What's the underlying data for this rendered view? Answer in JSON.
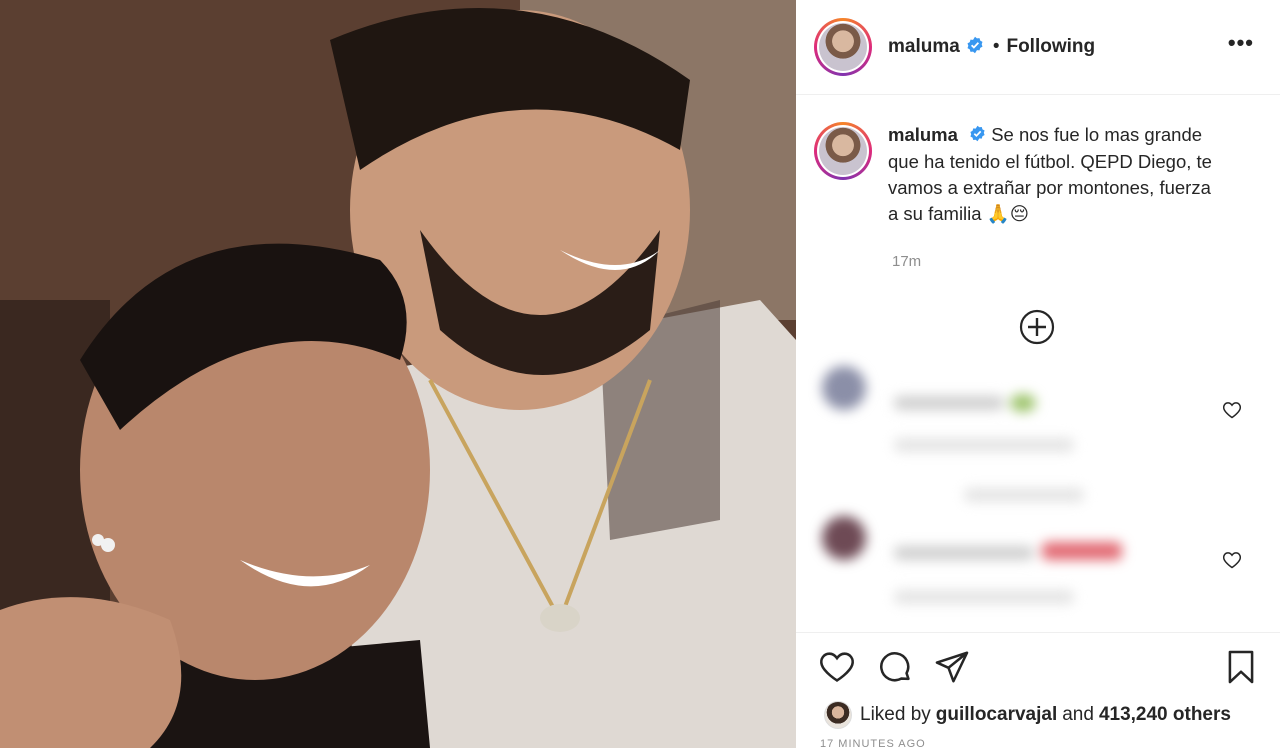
{
  "post": {
    "image_alt": "Photo of two smiling men embracing",
    "header": {
      "username": "maluma",
      "dot": "•",
      "follow_state": "Following",
      "more_label": "•••"
    },
    "caption": {
      "username": "maluma",
      "text": "Se nos fue lo mas grande que ha tenido el fútbol. QEPD Diego, te vamos a extrañar por montones, fuerza a su familia 🙏😔",
      "time": "17m"
    },
    "actions": {
      "like": "heart-icon",
      "comment": "comment-icon",
      "share": "paper-plane-icon",
      "save": "bookmark-icon"
    },
    "likes": {
      "prefix": "Liked by",
      "user": "guillocarvajal",
      "connector": "and",
      "others": "413,240 others"
    },
    "timestamp": "17 MINUTES AGO"
  },
  "colors": {
    "verified": "#3897f0",
    "text": "#262626",
    "muted": "#8e8e8e",
    "border": "#efefef"
  }
}
